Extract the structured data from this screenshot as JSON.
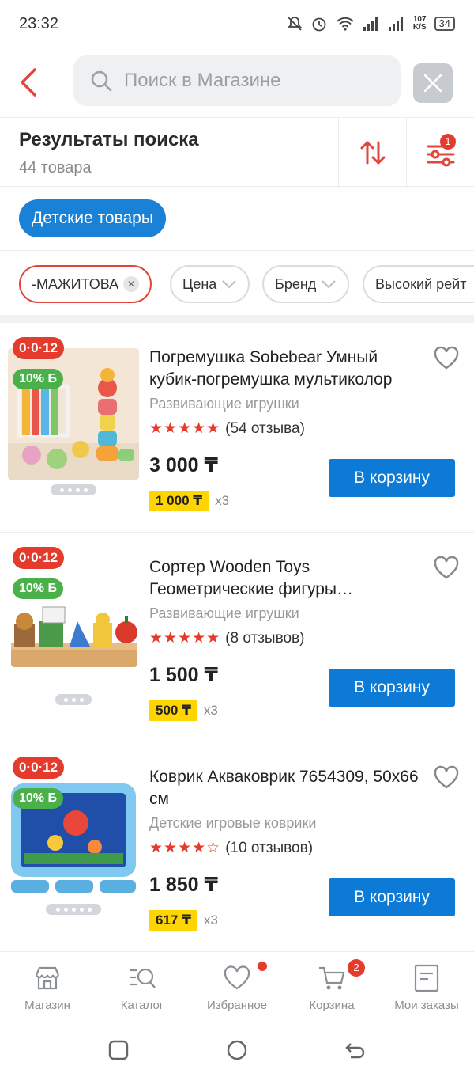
{
  "status": {
    "time": "23:32",
    "netspeed_value": "107",
    "netspeed_unit": "K/S",
    "battery": "34"
  },
  "search": {
    "placeholder": "Поиск в Магазине"
  },
  "results": {
    "title": "Результаты поиска",
    "count": "44 товара",
    "filter_badge": "1"
  },
  "category_chip": "Детские товары",
  "filters": [
    {
      "label": "-МАЖИТОВА",
      "active": true
    },
    {
      "label": "Цена"
    },
    {
      "label": "Бренд"
    },
    {
      "label": "Высокий рейт"
    }
  ],
  "products": [
    {
      "age_tag": "0·0·12",
      "bonus_tag": "10% Б",
      "title": "Погремушка Sobebear Умный кубик-погремушка мультиколор",
      "category": "Развивающие игрушки",
      "rating": 5,
      "reviews": "(54 отзыва)",
      "price": "3 000 ₸",
      "installment": "1 000 ₸",
      "installment_times": "х3",
      "cart_label": "В корзину"
    },
    {
      "age_tag": "0·0·12",
      "bonus_tag": "10% Б",
      "title": "Сортер Wooden Toys Геометрические фигуры…",
      "category": "Развивающие игрушки",
      "rating": 5,
      "reviews": "(8 отзывов)",
      "price": "1 500 ₸",
      "installment": "500 ₸",
      "installment_times": "х3",
      "cart_label": "В корзину"
    },
    {
      "age_tag": "0·0·12",
      "bonus_tag": "10% Б",
      "title": "Коврик Акваковрик 7654309, 50x66 см",
      "category": "Детские игровые коврики",
      "rating": 4,
      "reviews": "(10 отзывов)",
      "price": "1 850 ₸",
      "installment": "617 ₸",
      "installment_times": "х3",
      "cart_label": "В корзину"
    }
  ],
  "tabbar": {
    "shop": "Магазин",
    "catalog": "Каталог",
    "favorites": "Избранное",
    "cart": "Корзина",
    "cart_badge": "2",
    "orders": "Мои заказы"
  },
  "colors": {
    "accent_red": "#e53b2c",
    "primary_blue": "#0d7ad6",
    "chip_blue": "#1a82d6",
    "bonus_green": "#4ab14a",
    "installment_yellow": "#ffd500"
  }
}
